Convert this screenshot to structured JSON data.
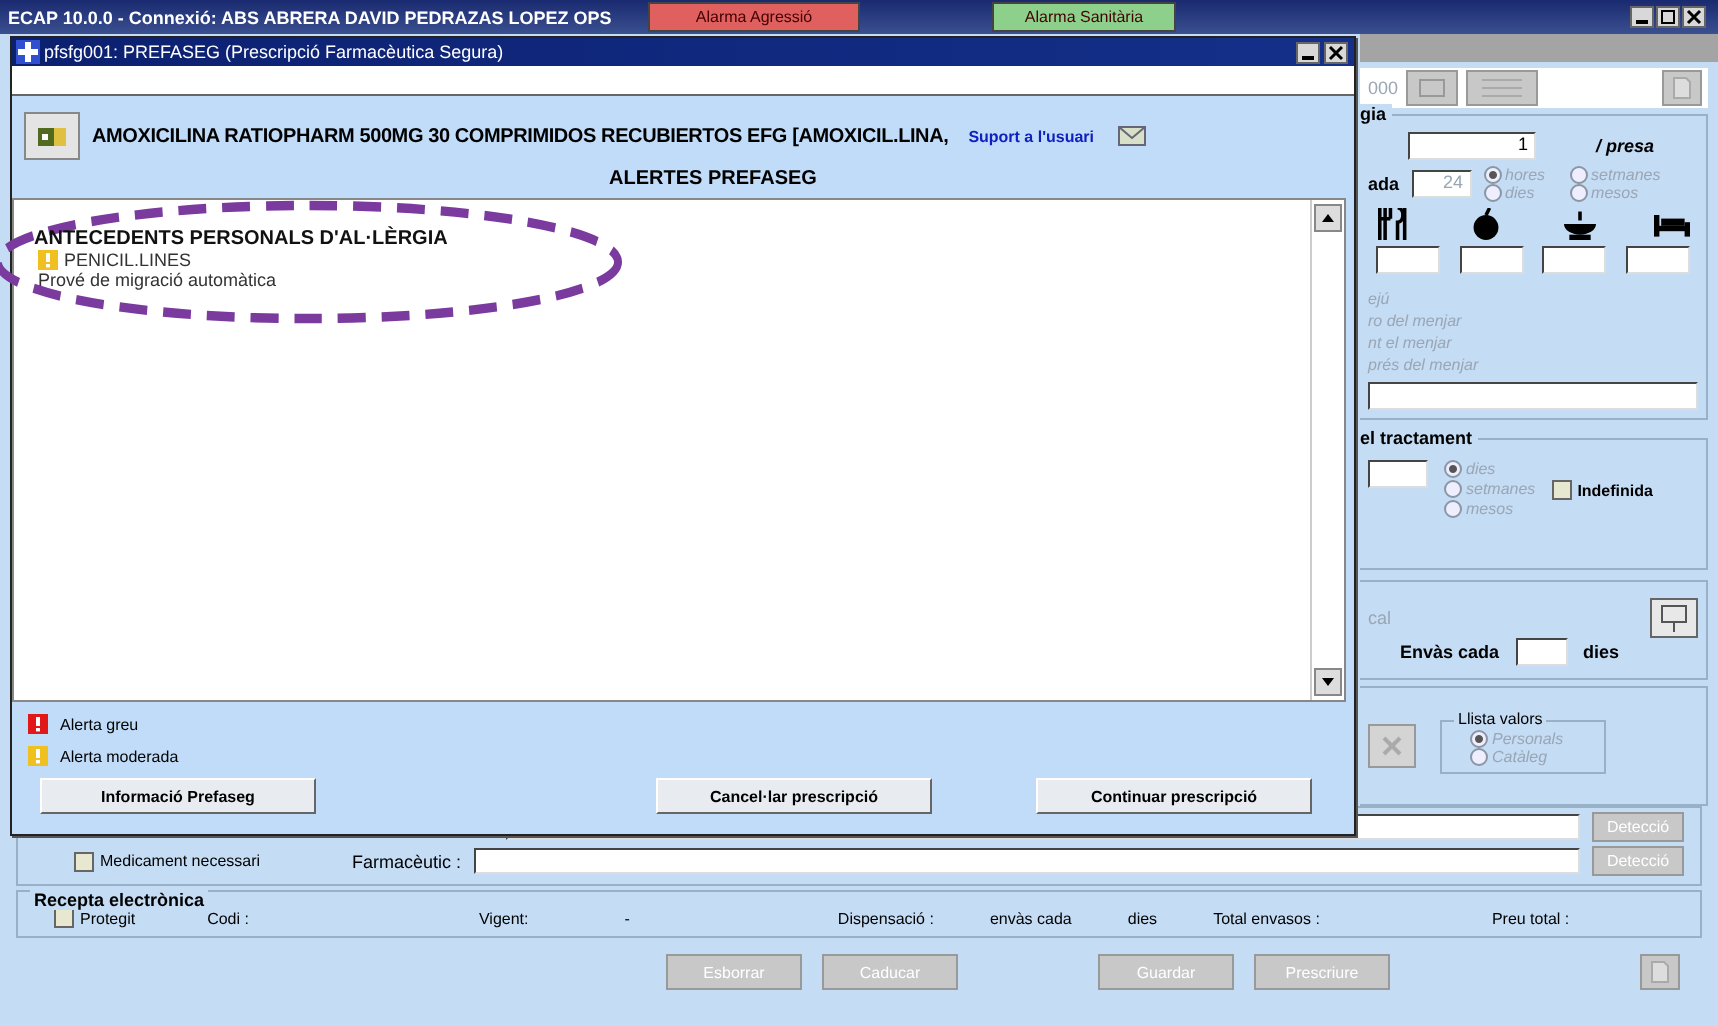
{
  "app": {
    "title": "ECAP 10.0.0 - Connexió: ABS ABRERA DAVID PEDRAZAS LOPEZ OPS",
    "alarms": [
      {
        "label": "Alarma Agressió",
        "color": "#e06060"
      },
      {
        "label": "Alarma Sanitària",
        "color": "#8cd08c"
      }
    ]
  },
  "dialog": {
    "title": "pfsfg001: PREFASEG (Prescripció Farmacèutica Segura)",
    "drug": "AMOXICILINA RATIOPHARM 500MG 30 COMPRIMIDOS RECUBIERTOS EFG [AMOXICIL.LINA,",
    "support_link": "Suport a l'usuari",
    "heading": "ALERTES PREFASEG",
    "alerts": [
      {
        "category": "ANTECEDENTS PERSONALS D'AL·LÈRGIA",
        "items": [
          {
            "name": "PENICIL.LINES",
            "color": "#f0c020",
            "note": "Prové de migració automàtica"
          }
        ]
      }
    ],
    "legend": [
      {
        "color": "#e01818",
        "label": "Alerta greu"
      },
      {
        "color": "#f0c020",
        "label": "Alerta moderada"
      }
    ],
    "buttons": [
      "Informació Prefaseg",
      "Cancel·lar prescripció",
      "Continuar prescripció"
    ]
  },
  "posology": {
    "code_fragment": "000",
    "group_label": "gia",
    "dose": "1",
    "dose_unit": "/ presa",
    "every_label": "ada",
    "every_value": "24",
    "units": [
      {
        "label": "hores",
        "selected": true
      },
      {
        "label": "setmanes",
        "selected": false
      },
      {
        "label": "dies",
        "selected": false
      },
      {
        "label": "mesos",
        "selected": false
      }
    ],
    "meal_timing": [
      "ejú",
      "ro del menjar",
      "nt el menjar",
      "prés del menjar"
    ]
  },
  "duration": {
    "group_label": "el tractament",
    "units": [
      {
        "label": "dies",
        "selected": true
      },
      {
        "label": "setmanes",
        "selected": false
      },
      {
        "label": "mesos",
        "selected": false
      }
    ],
    "indefinite": {
      "label": "Indefinida",
      "checked": false
    }
  },
  "dispensing": {
    "label_fragment": "cal",
    "every_label": "Envàs cada",
    "unit": "dies"
  },
  "value_list": {
    "label": "Llista valors",
    "options": [
      {
        "label": "Personals",
        "selected": true
      },
      {
        "label": "Catàleg",
        "selected": false
      }
    ]
  },
  "necessary": {
    "label": "Medicament necessari",
    "checked": false
  },
  "pharmacist_label": "Farmacèutic :",
  "detect_buttons": [
    "Detecció",
    "Detecció"
  ],
  "e_prescription": {
    "title": "Recepta electrònica",
    "protected": {
      "label": "Protegit",
      "checked": false
    },
    "fields": [
      "Codi :",
      "Vigent:",
      "-",
      "Dispensació :",
      "envàs cada",
      "dies",
      "Total envasos :",
      "Preu total :"
    ]
  },
  "actions": [
    "Esborrar",
    "Caducar",
    "Guardar",
    "Prescriure"
  ]
}
